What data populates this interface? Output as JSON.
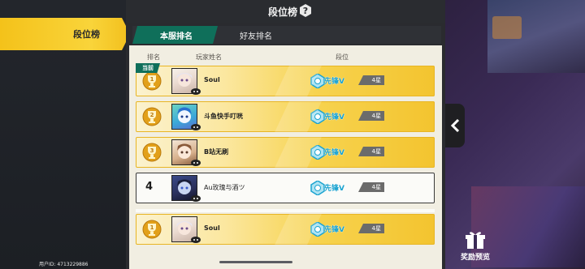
{
  "sidebar": {
    "active_tab": "段位榜",
    "user_id": "用户ID: 4713229886"
  },
  "header": {
    "title": "段位榜"
  },
  "tabs": [
    {
      "label": "本服排名",
      "active": true
    },
    {
      "label": "好友排名",
      "active": false
    }
  ],
  "columns": {
    "rank": "排名",
    "player": "玩家姓名",
    "tier": "段位"
  },
  "current_tag": "当前",
  "rows": [
    {
      "rank": 1,
      "name": "Soul",
      "tier": "先锋V",
      "stars": "4星",
      "current": true
    },
    {
      "rank": 2,
      "name": "斗鱼快手叮咣",
      "tier": "先锋V",
      "stars": "4星"
    },
    {
      "rank": 3,
      "name": "B站无刷",
      "tier": "先锋V",
      "stars": "4星"
    },
    {
      "rank": "4",
      "name": "Au玫瑰与酒ツ",
      "tier": "先锋V",
      "stars": "4星"
    }
  ],
  "self_row": {
    "rank": 1,
    "name": "Soul",
    "tier": "先锋V",
    "stars": "4星"
  },
  "reward": {
    "label": "奖励预览"
  },
  "colors": {
    "accent_green": "#0f6f5a",
    "gold": "#f4c21a",
    "tier_blue": "#1aa3d0"
  }
}
